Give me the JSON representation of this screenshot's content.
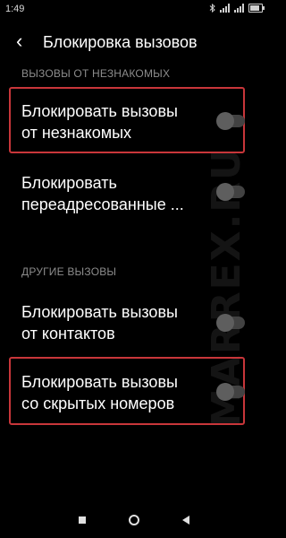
{
  "status_bar": {
    "time": "1:49",
    "battery_level": 0.8
  },
  "header": {
    "back_icon": "arrow-left-icon",
    "title": "Блокировка вызовов"
  },
  "sections": [
    {
      "label": "ВЫЗОВЫ ОТ НЕЗНАКОМЫХ",
      "items": [
        {
          "line1": "Блокировать вызовы",
          "line2": "от незнакомых",
          "enabled": false,
          "highlighted": true
        },
        {
          "line1": "Блокировать",
          "line2": "переадресованные ...",
          "enabled": false,
          "highlighted": false
        }
      ]
    },
    {
      "label": "ДРУГИЕ ВЫЗОВЫ",
      "items": [
        {
          "line1": "Блокировать вызовы",
          "line2": "от контактов",
          "enabled": false,
          "highlighted": false
        },
        {
          "line1": "Блокировать вызовы",
          "line2": "со скрытых номеров",
          "enabled": false,
          "highlighted": true
        }
      ]
    }
  ],
  "watermark": "MARREX.RU",
  "colors": {
    "highlight": "#c8363a",
    "background": "#000000",
    "section_label": "#8c8c8c"
  }
}
